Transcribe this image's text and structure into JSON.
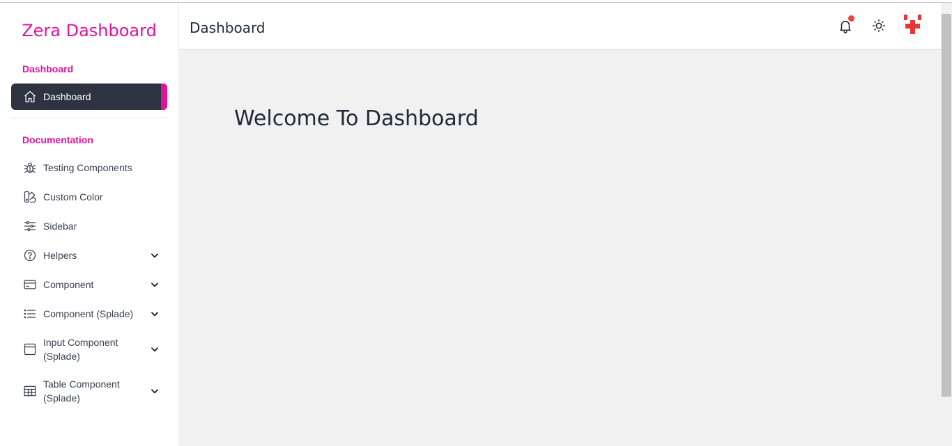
{
  "brand": "Zera Dashboard",
  "sidebar": {
    "section_dashboard": "Dashboard",
    "section_documentation": "Documentation",
    "items": [
      {
        "label": "Dashboard",
        "icon": "home-icon"
      },
      {
        "label": "Testing Components",
        "icon": "bug-icon"
      },
      {
        "label": "Custom Color",
        "icon": "palette-icon"
      },
      {
        "label": "Sidebar",
        "icon": "sliders-icon"
      },
      {
        "label": "Helpers",
        "icon": "question-circle-icon"
      },
      {
        "label": "Component",
        "icon": "card-icon"
      },
      {
        "label": "Component (Splade)",
        "icon": "list-icon"
      },
      {
        "label": "Input Component",
        "label2": "(Splade)",
        "icon": "window-icon"
      },
      {
        "label": "Table Component",
        "label2": "(Splade)",
        "icon": "table-icon"
      }
    ]
  },
  "header": {
    "title": "Dashboard"
  },
  "main": {
    "welcome": "Welcome To Dashboard"
  },
  "colors": {
    "accent": "#e4119d",
    "active_bg": "#2d3340",
    "notification": "#ef4444",
    "avatar_red": "#e53935"
  }
}
